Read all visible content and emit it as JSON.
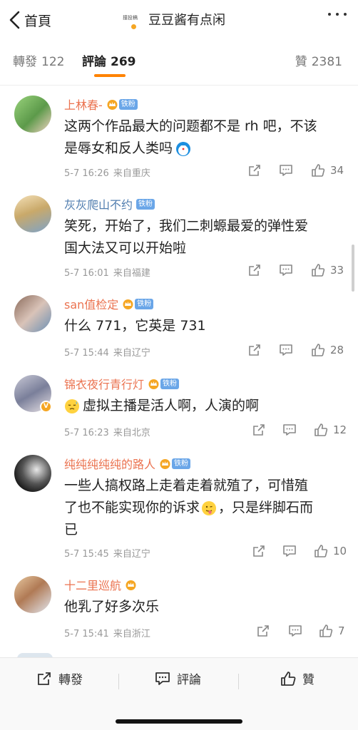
{
  "header": {
    "back_label": "首頁",
    "title": "豆豆酱有点闲",
    "mini_avatar_stamp": "撞投稿"
  },
  "tabs": {
    "forward": {
      "label": "轉發",
      "count": "122"
    },
    "comments": {
      "label": "評論",
      "count": "269"
    },
    "likes": {
      "label": "贊",
      "count": "2381"
    }
  },
  "comments": [
    {
      "name": "上林春-",
      "fan_badge": "铁粉",
      "text_lines": [
        "这两个作品最大的问题都不是 rh 吧，不该",
        "是辱女和反人类吗"
      ],
      "emoji": "doraemon-emoji",
      "time": "5-7 16:26",
      "location": "来自重庆",
      "likes": "34"
    },
    {
      "name": "灰灰爬山不约",
      "fan_badge": "铁粉",
      "text_lines": [
        "笑死，开始了，我们二刺螈最爱的弹性爱",
        "国大法又可以开始啦"
      ],
      "time": "5-7 16:01",
      "location": "来自福建",
      "likes": "33"
    },
    {
      "name": "san值检定",
      "fan_badge": "铁粉",
      "text_lines": [
        "什么 771，它英是 731"
      ],
      "time": "5-7 15:44",
      "location": "来自辽宁",
      "likes": "28"
    },
    {
      "name": "锦衣夜行青行灯",
      "fan_badge": "铁粉",
      "text_lines": [
        "虚拟主播是活人啊，人演的啊"
      ],
      "emoji": "sweat-emoji",
      "time": "5-7 16:23",
      "location": "来自北京",
      "likes": "12"
    },
    {
      "name": "纯纯纯纯纯的路人",
      "fan_badge": "铁粉",
      "text_lines": [
        "一些人搞权路上走着走着就殖了，可惜殖",
        "了也不能实现你的诉求",
        "，只是绊脚石而",
        "已"
      ],
      "emoji": "tongue-emoji",
      "time": "5-7 15:45",
      "location": "来自辽宁",
      "likes": "10"
    },
    {
      "name": "十二里巡航",
      "text_lines": [
        "他乳了好多次乐"
      ],
      "time": "5-7 15:41",
      "location": "来自浙江",
      "likes": "7"
    }
  ],
  "bottom_bar": {
    "forward_label": "轉發",
    "comment_label": "評論",
    "like_label": "贊"
  },
  "colors": {
    "accent": "#ff8200",
    "username": "#eb7350",
    "username_blue": "#507daf",
    "fan_badge": "#6aa6e8"
  }
}
